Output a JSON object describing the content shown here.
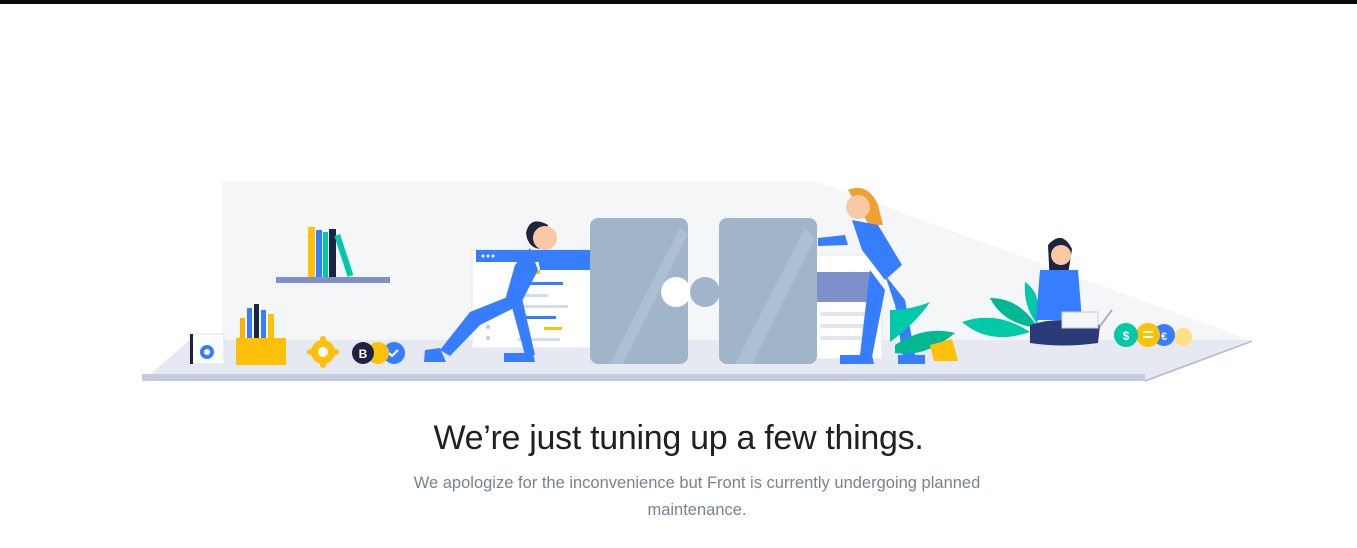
{
  "page": {
    "title": "We’re just tuning up a few things.",
    "description": "We apologize for the inconvenience but Front is currently undergoing planned maintenance."
  },
  "illustration": {
    "coin_labels": [
      "B",
      "$",
      "€"
    ],
    "colors": {
      "primary_blue": "#377dff",
      "yellow": "#ffc107",
      "puzzle_gray": "#a0b5c9",
      "backdrop": "#f5f6f8",
      "floor": "#e6e9f2",
      "green": "#00c9a7",
      "dark_navy": "#1e2340"
    }
  }
}
